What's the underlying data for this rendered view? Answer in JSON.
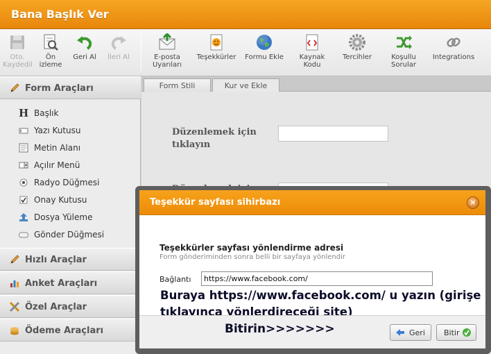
{
  "app": {
    "title": "Bana Başlık Ver"
  },
  "toolbar": {
    "items": [
      {
        "label": "Oto. Kaydedil",
        "icon": "save-icon",
        "disabled": true
      },
      {
        "label": "Ön izleme",
        "icon": "preview-icon",
        "disabled": false
      },
      {
        "label": "Geri Al",
        "icon": "undo-icon",
        "disabled": false
      },
      {
        "label": "İleri Al",
        "icon": "redo-icon",
        "disabled": true
      },
      {
        "label": "E-posta Uyarıları",
        "icon": "email-icon",
        "disabled": false
      },
      {
        "label": "Teşekkürler",
        "icon": "thanks-icon",
        "disabled": false
      },
      {
        "label": "Formu Ekle",
        "icon": "globe-icon",
        "disabled": false
      },
      {
        "label": "Kaynak Kodu",
        "icon": "source-code-icon",
        "disabled": false
      },
      {
        "label": "Tercihler",
        "icon": "gear-icon",
        "disabled": false
      },
      {
        "label": "Koşullu Sorular",
        "icon": "conditional-icon",
        "disabled": false
      },
      {
        "label": "Integrations",
        "icon": "link-icon",
        "disabled": false
      }
    ]
  },
  "sidebar": {
    "form_tools_label": "Form Araçları",
    "items": [
      {
        "label": "Başlık",
        "icon": "heading-icon"
      },
      {
        "label": "Yazı Kutusu",
        "icon": "textbox-icon"
      },
      {
        "label": "Metin Alanı",
        "icon": "textarea-icon"
      },
      {
        "label": "Açılır Menü",
        "icon": "dropdown-icon"
      },
      {
        "label": "Radyo Düğmesi",
        "icon": "radio-icon"
      },
      {
        "label": "Onay Kutusu",
        "icon": "checkbox-icon"
      },
      {
        "label": "Dosya Yüleme",
        "icon": "upload-icon"
      },
      {
        "label": "Gönder Düğmesi",
        "icon": "submit-button-icon"
      }
    ],
    "sections": [
      {
        "label": "Hızlı Araçlar",
        "icon": "quick-tools-icon"
      },
      {
        "label": "Anket Araçları",
        "icon": "survey-tools-icon"
      },
      {
        "label": "Özel Araçlar",
        "icon": "special-tools-icon"
      },
      {
        "label": "Ödeme Araçları",
        "icon": "payment-tools-icon"
      }
    ]
  },
  "tabs": [
    {
      "label": "Form Stili",
      "active": false
    },
    {
      "label": "Kur ve Ekle",
      "active": true
    }
  ],
  "form": {
    "field1_label": "Düzenlemek için tıklayın",
    "field2_label": "Düzenlemek için"
  },
  "dialog": {
    "title": "Teşekkür sayfası sihirbazı",
    "heading": "Teşekkürler sayfası yönlendirme adresi",
    "subheading": "Form gönderiminden sonra belli bir sayfaya yönlendir",
    "link_label": "Bağlantı",
    "link_value": "https://www.facebook.com/",
    "annotation": "Buraya https://www.facebook.com/ u yazın (girişe tıklayınca yönlerdireceği site)",
    "finish_note": "Bitirin>>>>>>>",
    "back_label": "Geri",
    "finish_label": "Bitir"
  },
  "colors": {
    "accent": "#f0960f",
    "accent_dark": "#c97400"
  }
}
